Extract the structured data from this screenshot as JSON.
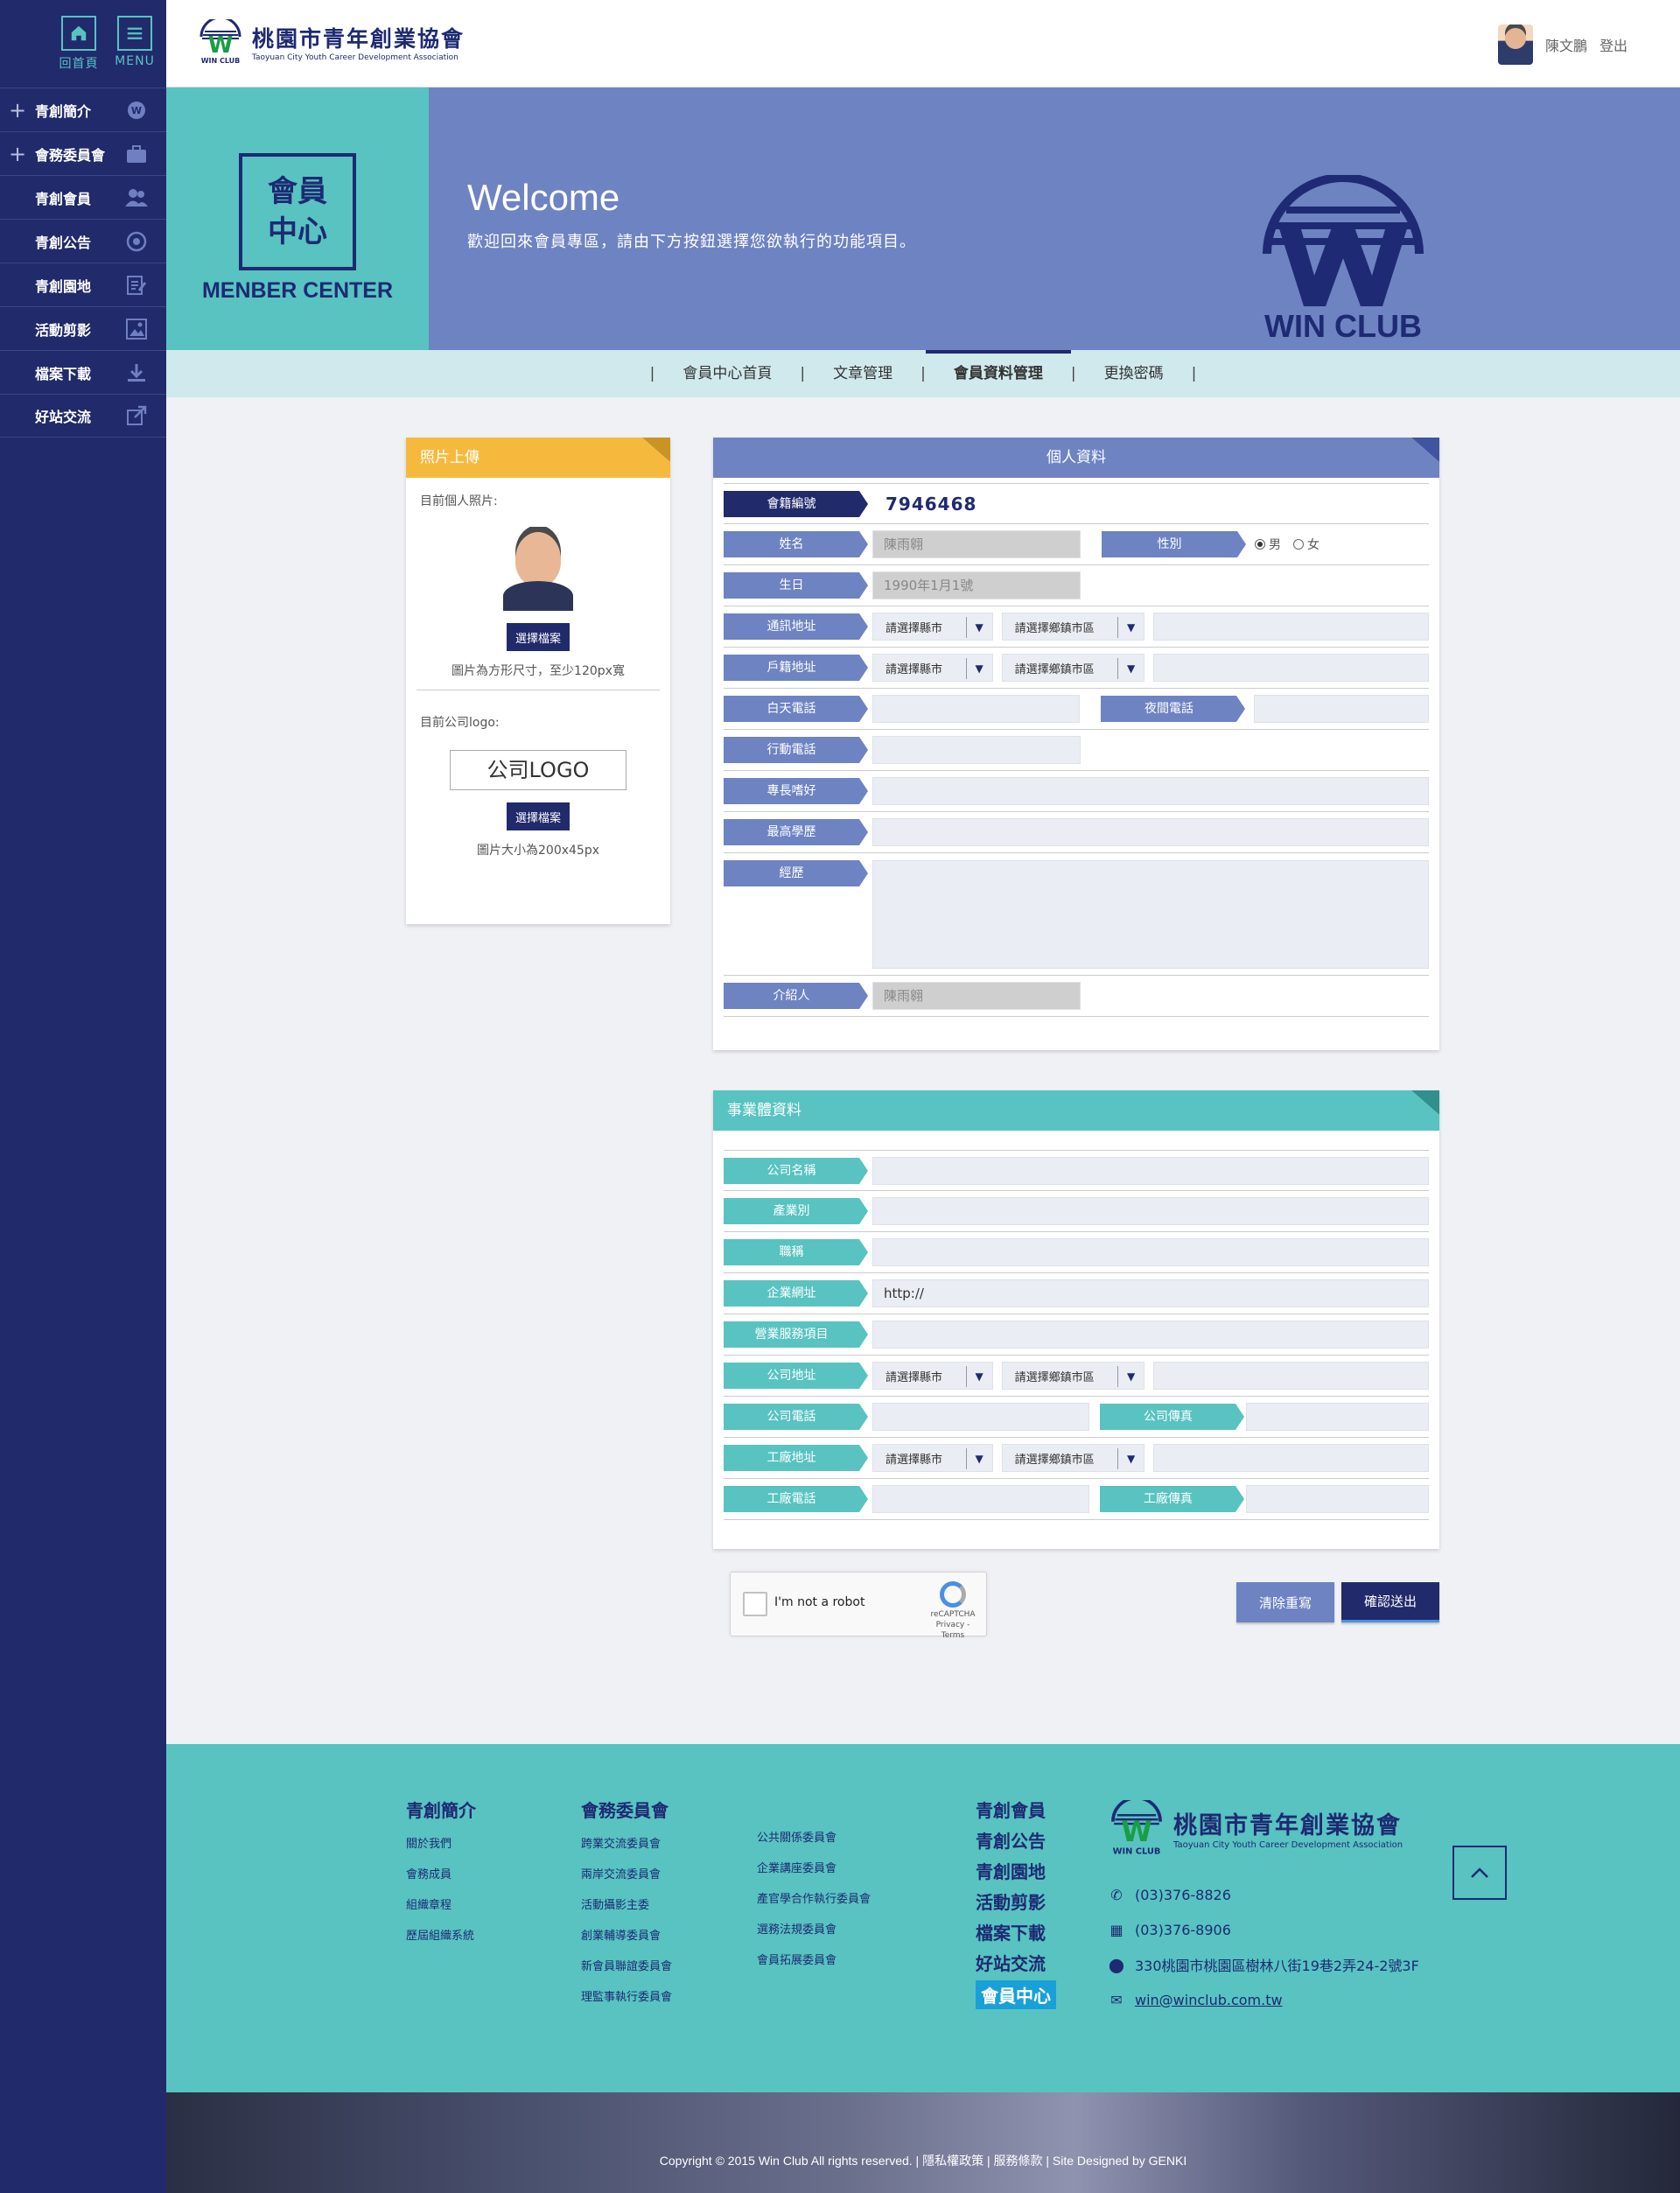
{
  "sidebar": {
    "top": [
      {
        "label": "回首頁",
        "icon": "home-icon"
      },
      {
        "label": "MENU",
        "icon": "menu-icon"
      }
    ],
    "items": [
      {
        "label": "青創簡介",
        "plus": "+",
        "icon": "wclub-icon"
      },
      {
        "label": "會務委員會",
        "plus": "+",
        "icon": "briefcase-icon"
      },
      {
        "label": "青創會員",
        "plus": "",
        "icon": "users-icon"
      },
      {
        "label": "青創公告",
        "plus": "",
        "icon": "globe-icon"
      },
      {
        "label": "青創園地",
        "plus": "",
        "icon": "edit-icon"
      },
      {
        "label": "活動剪影",
        "plus": "",
        "icon": "image-icon"
      },
      {
        "label": "檔案下載",
        "plus": "",
        "icon": "download-icon"
      },
      {
        "label": "好站交流",
        "plus": "",
        "icon": "external-link-icon"
      }
    ]
  },
  "header": {
    "logo_name": "桃園市青年創業協會",
    "logo_en": "Taoyuan City Youth Career Development Association",
    "logo_mark": "WIN CLUB",
    "user_name": "陳文鵬",
    "logout": "登出"
  },
  "banner": {
    "mc_title": "會員\n中心",
    "mc_label": "MENBER CENTER",
    "welcome": "Welcome",
    "subtitle": "歡迎回來會員專區，請由下方按鈕選擇您欲執行的功能項目。",
    "brand": "WIN CLUB"
  },
  "tabs": [
    {
      "label": "會員中心首頁",
      "active": false
    },
    {
      "label": "文章管理",
      "active": false
    },
    {
      "label": "會員資料管理",
      "active": true
    },
    {
      "label": "更換密碼",
      "active": false
    }
  ],
  "photo": {
    "title": "照片上傳",
    "current_photo": "目前個人照片:",
    "choose1": "選擇檔案",
    "note1": "圖片為方形尺寸，至少120px寬",
    "current_logo": "目前公司logo:",
    "logo_placeholder": "公司LOGO",
    "choose2": "選擇檔案",
    "note2": "圖片大小為200x45px"
  },
  "personal": {
    "title": "個人資料",
    "member_no_label": "會籍編號",
    "member_no": "7946468",
    "name_label": "姓名",
    "name": "陳雨翱",
    "gender_label": "性別",
    "male": "男",
    "female": "女",
    "gender_selected": "男",
    "birthday_label": "生日",
    "birthday": "1990年1月1號",
    "mail_addr_label": "通訊地址",
    "reg_addr_label": "戶籍地址",
    "city_placeholder": "請選擇縣市",
    "district_placeholder": "請選擇鄉鎮市區",
    "day_phone_label": "白天電話",
    "night_phone_label": "夜間電話",
    "mobile_label": "行動電話",
    "hobby_label": "專長嗜好",
    "education_label": "最高學歷",
    "experience_label": "經歷",
    "referrer_label": "介紹人",
    "referrer": "陳雨翱"
  },
  "business": {
    "title": "事業體資料",
    "company_label": "公司名稱",
    "industry_label": "產業別",
    "job_title_label": "職稱",
    "website_label": "企業網址",
    "website": "http://",
    "services_label": "營業服務項目",
    "company_addr_label": "公司地址",
    "company_phone_label": "公司電話",
    "company_fax_label": "公司傳真",
    "factory_addr_label": "工廠地址",
    "factory_phone_label": "工廠電話",
    "factory_fax_label": "工廠傳真"
  },
  "actions": {
    "captcha_text": "I'm not a robot",
    "captcha_brand": "reCAPTCHA",
    "captcha_links": "Privacy - Terms",
    "clear": "清除重寫",
    "submit": "確認送出"
  },
  "footer": {
    "col1": {
      "title": "青創簡介",
      "items": [
        "關於我們",
        "會務成員",
        "組織章程",
        "歷屆組織系統"
      ]
    },
    "col2": {
      "title": "會務委員會",
      "items": [
        "跨業交流委員會",
        "兩岸交流委員會",
        "活動攝影主委",
        "創業輔導委員會",
        "新會員聯誼委員會",
        "理監事執行委員會"
      ]
    },
    "col3": {
      "items": [
        "公共關係委員會",
        "企業講座委員會",
        "產官學合作執行委員會",
        "選務法規委員會",
        "會員拓展委員會"
      ]
    },
    "col4": {
      "items": [
        "青創會員",
        "青創公告",
        "青創園地",
        "活動剪影",
        "檔案下載",
        "好站交流"
      ],
      "cta": "會員中心"
    },
    "logo_name": "桃園市青年創業協會",
    "logo_en": "Taoyuan City Youth Career Development Association",
    "logo_mark": "WIN CLUB",
    "phone": "(03)376-8826",
    "fax": "(03)376-8906",
    "address": "330桃園市桃園區樹林八街19巷2弄24-2號3F",
    "email": "win@winclub.com.tw",
    "copyright": "Copyright © 2015 Win Club  All rights reserved.  |  隱私權政策  |  服務條款  |  Site Designed by GENKI"
  },
  "colors": {
    "navy": "#212a6b",
    "teal": "#58c3c1",
    "periwinkle": "#6e83c2",
    "yellow": "#f5ba3d",
    "light_blue_tab": "#d0e9ed"
  }
}
